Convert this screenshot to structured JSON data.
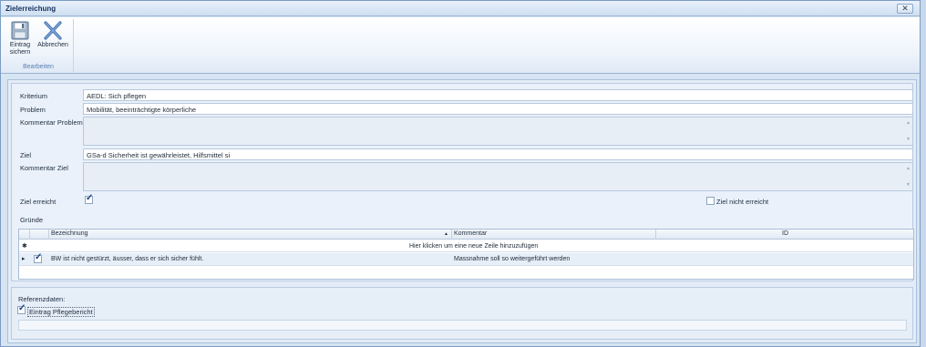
{
  "window": {
    "title": "Zielerreichung",
    "close_glyph": "✕"
  },
  "ribbon": {
    "buttons": [
      {
        "label_line1": "Eintrag",
        "label_line2": "sichern",
        "icon": "floppy-disk-icon"
      },
      {
        "label_line1": "Abbrechen",
        "icon": "close-x-icon"
      }
    ],
    "group_label": "Bearbeiten"
  },
  "form": {
    "kriterium": {
      "label": "Kriterium",
      "value": "AEDL: Sich pflegen"
    },
    "problem": {
      "label": "Problem",
      "value": "Mobilität, beeinträchtigte körperliche"
    },
    "kommentar_problem": {
      "label": "Kommentar Problem",
      "value": ""
    },
    "ziel": {
      "label": "Ziel",
      "value": "GSa-d Sicherheit ist gewährleistet, Hilfsmittel si"
    },
    "kommentar_ziel": {
      "label": "Kommentar Ziel",
      "value": ""
    },
    "ziel_erreicht": {
      "label": "Ziel erreicht",
      "checked": true
    },
    "ziel_nicht_erreicht": {
      "label": "Ziel nicht erreicht",
      "checked": false
    }
  },
  "gruende": {
    "label": "Gründe",
    "columns": [
      "Bezeichnung",
      "Kommentar",
      "ID"
    ],
    "sort_glyph": "▲",
    "new_row_marker": "✱",
    "new_row_text": "Hier klicken um eine neue Zeile hinzuzufügen",
    "row_marker": "▸",
    "rows": [
      {
        "checked": true,
        "bezeichnung": "BW ist nicht gestürzt, äusser, dass er sich sicher fühlt.",
        "kommentar": "Massnahme soll so weitergeführt werden",
        "id": ""
      }
    ]
  },
  "referenz": {
    "label": "Referenzdaten:",
    "eintrag_pflegebericht": {
      "label": "Eintrag Pflegebericht",
      "checked": true
    }
  },
  "colors": {
    "accent": "#1a3f7d",
    "background": "#d7e4f2",
    "title_text": "#14325c"
  }
}
